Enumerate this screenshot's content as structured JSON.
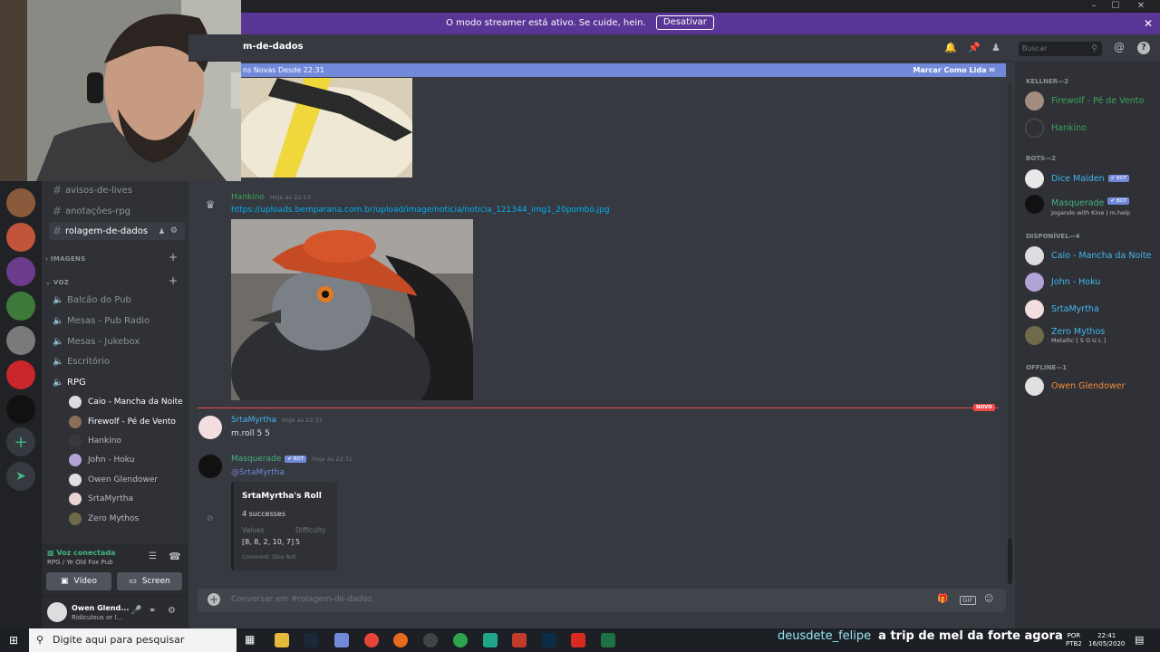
{
  "window": {
    "minimize": "–",
    "maximize": "☐",
    "close": "✕"
  },
  "banner": {
    "text": "O modo streamer está ativo. Se cuide, hein.",
    "button": "Desativar",
    "close": "✕"
  },
  "channels": {
    "text": [
      "avisos-de-lives",
      "anotações-rpg",
      "rolagem-de-dados"
    ],
    "active": "rolagem-de-dados",
    "categories": {
      "images": "IMAGENS",
      "voice": "VOZ"
    },
    "voice": [
      "Balcão do Pub",
      "Mesas - Pub Radio",
      "Mesas - Jukebox",
      "Escritório",
      "RPG"
    ],
    "rpg_users": [
      "Caio - Mancha da Noite",
      "Firewolf - Pé de Vento",
      "Hankino",
      "John - Hoku",
      "Owen Glendower",
      "SrtaMyrtha",
      "Zero Mythos"
    ]
  },
  "voice_panel": {
    "status": "Voz conectada",
    "location": "RPG / Ye Old Fox Pub",
    "video": "Vídeo",
    "screen": "Screen"
  },
  "user_panel": {
    "name": "Owen Glend...",
    "status": "Ridiculous or l..."
  },
  "header": {
    "channel": "m-de-dados",
    "search_placeholder": "Buscar"
  },
  "new_bar": {
    "text": "ns Novas Desde 22:31",
    "mark_read": "Marcar Como Lida"
  },
  "messages": [
    {
      "author": "Hankino",
      "time": "Hoje às 22:13",
      "link": "https://uploads.bemparana.com.br/upload/image/noticia/noticia_121344_img1_20pombo.jpg"
    },
    {
      "author": "SrtaMyrtha",
      "time": "Hoje às 22:31",
      "text": "m.roll 5 5"
    },
    {
      "author": "Masquerade",
      "bot": "✔ BOT",
      "time": "Hoje às 22:31",
      "mention": "@SrtaMyrtha"
    }
  ],
  "new_badge": "NOVO",
  "embed": {
    "title": "SrtaMyrtha's Roll",
    "description": "4 successes",
    "field1_name": "Values",
    "field1_value": "[8, 8, 2, 10, 7]",
    "field2_name": "Difficulty",
    "field2_value": "5",
    "footer": "Comment: Dice Roll"
  },
  "composer": {
    "placeholder": "Conversar em #rolagem-de-dados",
    "gif": "GIF"
  },
  "members": {
    "group1": "KELLNER—2",
    "group2": "BOTS—2",
    "group3": "DISPONÍVEL—4",
    "group4": "OFFLINE—1",
    "kellner": [
      {
        "name": "Firewolf - Pé de Vento"
      },
      {
        "name": "Hankino"
      }
    ],
    "bots": [
      {
        "name": "Dice Maiden",
        "badge": "✔ BOT"
      },
      {
        "name": "Masquerade",
        "badge": "✔ BOT",
        "activity": "Jogando with Kine | m.help"
      }
    ],
    "online": [
      {
        "name": "Caio - Mancha da Noite"
      },
      {
        "name": "John - Hoku"
      },
      {
        "name": "SrtaMyrtha"
      },
      {
        "name": "Zero Mythos",
        "activity": "Metallic [ S O U L ]"
      }
    ],
    "offline": [
      {
        "name": "Owen Glendower"
      }
    ]
  },
  "taskbar": {
    "search": "Digite aqui para pesquisar",
    "chat_user": "deusdete_felipe",
    "chat_text": "a trip de mel da forte agora",
    "lang1": "POR",
    "lang2": "PTB2",
    "time": "22:41",
    "date": "16/05/2020"
  },
  "colors": {
    "accent": "#7289da",
    "streamer": "#593695",
    "new_line": "#f04747",
    "green": "#43b581"
  }
}
